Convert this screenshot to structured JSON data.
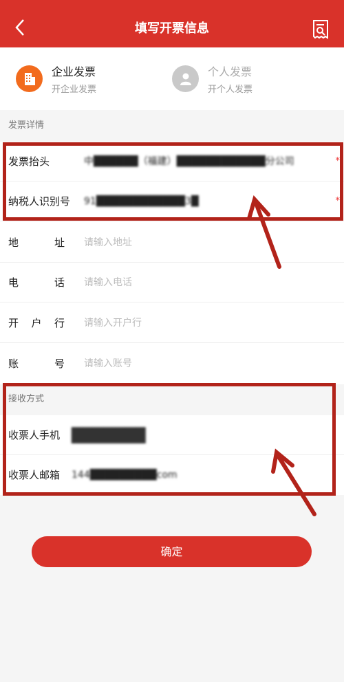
{
  "header": {
    "title": "填写开票信息",
    "back_icon": "back-chevron-icon",
    "receipt_icon": "receipt-search-icon",
    "bg_color": "#d9322a"
  },
  "invoice_type": {
    "options": [
      {
        "label": "企业发票",
        "sub": "开企业发票",
        "icon": "building-icon",
        "selected": true
      },
      {
        "label": "个人发票",
        "sub": "开个人发票",
        "icon": "person-icon",
        "selected": false
      }
    ]
  },
  "details": {
    "section_label": "发票详情",
    "rows": [
      {
        "label": "发票抬头",
        "value": "中██████（福建）████████████分公司",
        "required_mark": "*"
      },
      {
        "label": "纳税人识别号",
        "value": "91████████████3█",
        "required_mark": "*"
      },
      {
        "label": "地址",
        "placeholder": "请输入地址"
      },
      {
        "label": "电话",
        "placeholder": "请输入电话"
      },
      {
        "label": "开户行",
        "placeholder": "请输入开户行"
      },
      {
        "label": "账号",
        "placeholder": "请输入账号"
      }
    ]
  },
  "receive": {
    "section_label": "接收方式",
    "rows": [
      {
        "label": "收票人手机",
        "value": "███████"
      },
      {
        "label": "收票人邮箱",
        "value": "144█████████com"
      }
    ]
  },
  "confirm_label": "确定",
  "colors": {
    "accent": "#d9322a",
    "annotation": "#b2231a",
    "corp_icon": "#f26b1d"
  }
}
